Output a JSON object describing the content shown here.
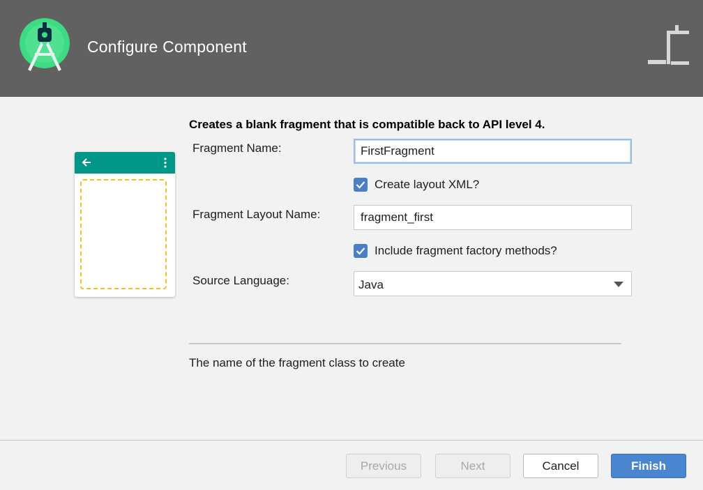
{
  "dialog": {
    "title": "Configure Component",
    "logo_icon": "android-studio-logo-icon",
    "corner_icon": "component-icon"
  },
  "template": {
    "description": "Creates a blank fragment that is compatible back to API level 4.",
    "preview_icons": [
      "back-arrow-icon",
      "overflow-menu-icon"
    ]
  },
  "form": {
    "fragment_name_label": "Fragment Name:",
    "fragment_name_value": "FirstFragment",
    "create_layout_label": "Create layout XML?",
    "create_layout_checked": true,
    "layout_name_label": "Fragment Layout Name:",
    "layout_name_value": "fragment_first",
    "factory_methods_label": "Include fragment factory methods?",
    "factory_methods_checked": true,
    "source_language_label": "Source Language:",
    "source_language_value": "Java"
  },
  "hint": "The name of the fragment class to create",
  "buttons": {
    "previous": "Previous",
    "next": "Next",
    "cancel": "Cancel",
    "finish": "Finish"
  },
  "colors": {
    "header": "#616161",
    "accent": "#4a86cf",
    "preview_bar": "#009688",
    "fragment_outline": "#f7c11b",
    "logo_green": "#3ddc84"
  }
}
